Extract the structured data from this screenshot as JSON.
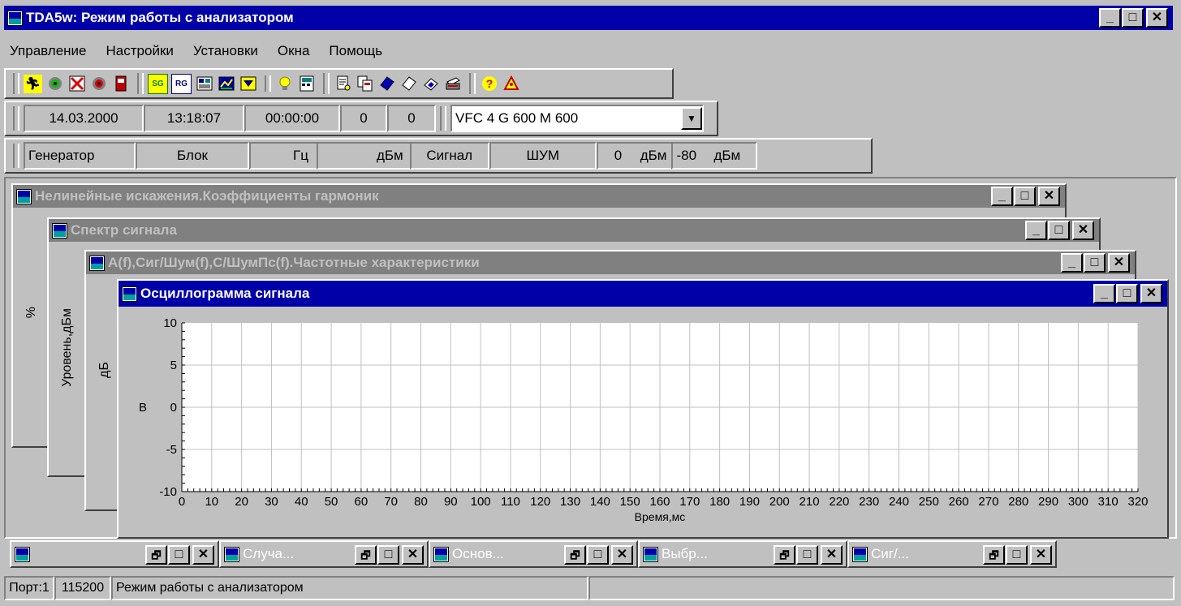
{
  "window": {
    "title": "TDA5w: Режим работы с анализатором"
  },
  "menu": [
    "Управление",
    "Настройки",
    "Установки",
    "Окна",
    "Помощь"
  ],
  "toolbar_icons": [
    "run-icon",
    "target-icon",
    "stop-run-icon",
    "record-icon",
    "door-icon",
    "sg-icon",
    "rg-icon",
    "display-icon",
    "graph-icon",
    "filter-icon",
    "bulb-icon",
    "calc-icon",
    "print-icon",
    "copy-icon",
    "save-icon",
    "open-icon",
    "eraser-icon",
    "printer-icon",
    "help-icon",
    "about-icon"
  ],
  "toolbar_labels": {
    "sg": "SG",
    "rg": "RG"
  },
  "status1": {
    "date": "14.03.2000",
    "time": "13:18:07",
    "elapsed": "00:00:00",
    "count1": "0",
    "count2": "0",
    "preset": "VFC 4 G 600 M 600"
  },
  "status2": {
    "gen_label": "Генератор",
    "gen_mode": "Блок",
    "gen_freq": "",
    "hz": "Гц",
    "gen_level": "",
    "dbm1": "дБм",
    "sig_label": "Сигнал",
    "sig_type": "ШУМ",
    "sig_level": "0",
    "dbm2": "дБм",
    "sig_level2": "-80",
    "dbm3": "дБм"
  },
  "child_windows": [
    {
      "title": "Нелинейные искажения.Коэффициенты гармоник",
      "axis_label": "%"
    },
    {
      "title": "Спектр сигнала",
      "axis_label": "Уровень,дБм"
    },
    {
      "title": "A(f),Сиг/Шум(f),С/ШумПс(f).Частотные характеристики",
      "axis_label": "дБ"
    },
    {
      "title": "Осциллограмма сигнала"
    }
  ],
  "chart_data": {
    "type": "line",
    "title": "",
    "xlabel": "Время,мс",
    "ylabel": "В",
    "xlim": [
      0,
      320
    ],
    "ylim": [
      -10,
      10
    ],
    "x_ticks": [
      0,
      10,
      20,
      30,
      40,
      50,
      60,
      70,
      80,
      90,
      100,
      110,
      120,
      130,
      140,
      150,
      160,
      170,
      180,
      190,
      200,
      210,
      220,
      230,
      240,
      250,
      260,
      270,
      280,
      290,
      300,
      310,
      320
    ],
    "y_ticks": [
      10,
      5,
      0,
      -5,
      -10
    ],
    "grid": true,
    "series": []
  },
  "taskbar": [
    {
      "label": ""
    },
    {
      "label": "Случа..."
    },
    {
      "label": "Основ..."
    },
    {
      "label": "Выбр..."
    },
    {
      "label": "Сиг/..."
    }
  ],
  "statusbar": {
    "port": "Порт:1",
    "baud": "115200",
    "mode": "Режим работы с анализатором"
  },
  "controls": {
    "minimize": "_",
    "maximize": "□",
    "close": "✕",
    "restore": "🗗"
  }
}
